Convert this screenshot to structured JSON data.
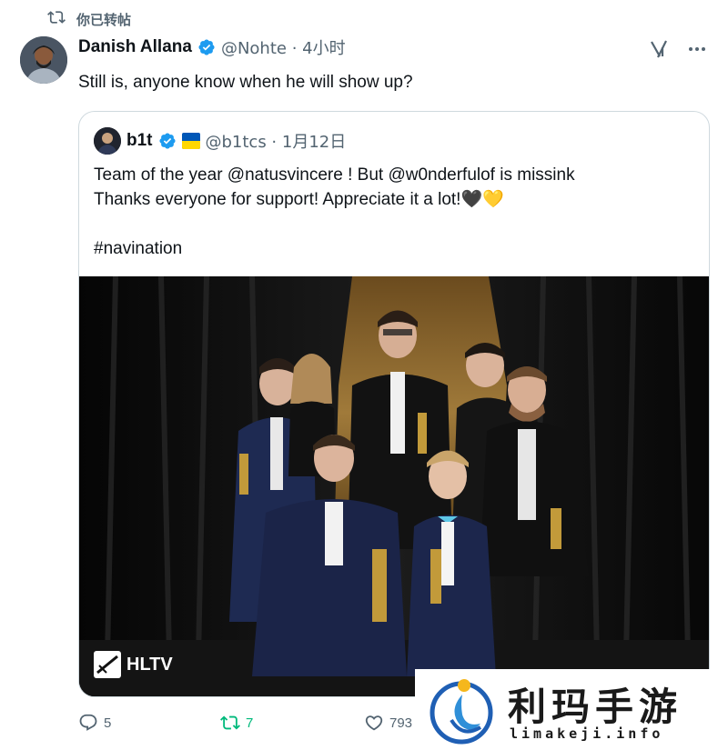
{
  "repost": {
    "label": "你已转帖"
  },
  "author": {
    "name": "Danish Allana",
    "handle_time": "@Nohte · 4小时"
  },
  "tweet": {
    "text": "Still is, anyone know when he will show up?"
  },
  "quote": {
    "name": "b1t",
    "handle_time": "@b1tcs · 1月12日",
    "text": "Team of the year @natusvincere ! But @w0nderfulof is missink\nThanks everyone for support! Appreciate it a lot!🖤💛\n\n#navination",
    "photo_watermark": "HLTV"
  },
  "actions": {
    "replies": "5",
    "reposts": "7",
    "likes": "793"
  },
  "colors": {
    "accent": "#1d9bf0",
    "repost_active": "#00ba7c",
    "muted": "#536471"
  },
  "site_watermark": {
    "title": "利玛手游",
    "url": "limakeji.info"
  }
}
